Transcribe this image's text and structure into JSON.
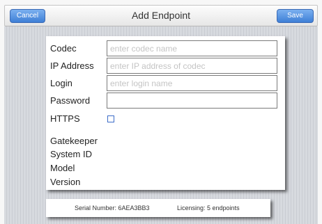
{
  "header": {
    "title": "Add Endpoint",
    "cancel_label": "Cancel",
    "save_label": "Save"
  },
  "form": {
    "codec": {
      "label": "Codec",
      "value": "",
      "placeholder": "enter codec name"
    },
    "ip_address": {
      "label": "IP Address",
      "value": "",
      "placeholder": "enter IP address of codec"
    },
    "login": {
      "label": "Login",
      "value": "",
      "placeholder": "enter login name"
    },
    "password": {
      "label": "Password",
      "value": "",
      "placeholder": ""
    },
    "https": {
      "label": "HTTPS",
      "checked": false
    }
  },
  "info": {
    "gatekeeper_label": "Gatekeeper",
    "system_id_label": "System ID",
    "model_label": "Model",
    "version_label": "Version"
  },
  "footer": {
    "serial": "Serial Number: 6AEA3BB3",
    "licensing": "Licensing: 5 endpoints"
  },
  "colors": {
    "button_blue": "#4a8ae0",
    "checkbox_border": "#3c6cc8",
    "background_stripe": "#d4d7dc"
  },
  "icons": {
    "https_checkbox": "checkbox-icon"
  }
}
